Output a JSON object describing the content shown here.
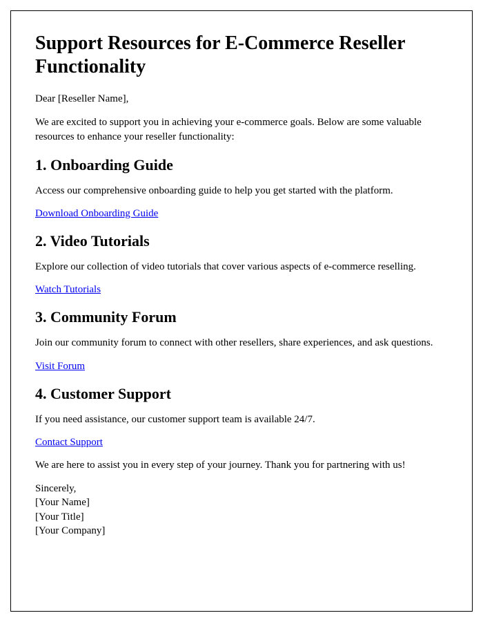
{
  "title": "Support Resources for E-Commerce Reseller Functionality",
  "greeting": "Dear [Reseller Name],",
  "intro": "We are excited to support you in achieving your e-commerce goals. Below are some valuable resources to enhance your reseller functionality:",
  "sections": [
    {
      "heading": "1. Onboarding Guide",
      "body": "Access our comprehensive onboarding guide to help you get started with the platform.",
      "link": "Download Onboarding Guide"
    },
    {
      "heading": "2. Video Tutorials",
      "body": "Explore our collection of video tutorials that cover various aspects of e-commerce reselling.",
      "link": "Watch Tutorials"
    },
    {
      "heading": "3. Community Forum",
      "body": "Join our community forum to connect with other resellers, share experiences, and ask questions.",
      "link": "Visit Forum"
    },
    {
      "heading": "4. Customer Support",
      "body": "If you need assistance, our customer support team is available 24/7.",
      "link": "Contact Support"
    }
  ],
  "closing": "We are here to assist you in every step of your journey. Thank you for partnering with us!",
  "signoff": {
    "line1": "Sincerely,",
    "line2": "[Your Name]",
    "line3": "[Your Title]",
    "line4": "[Your Company]"
  }
}
